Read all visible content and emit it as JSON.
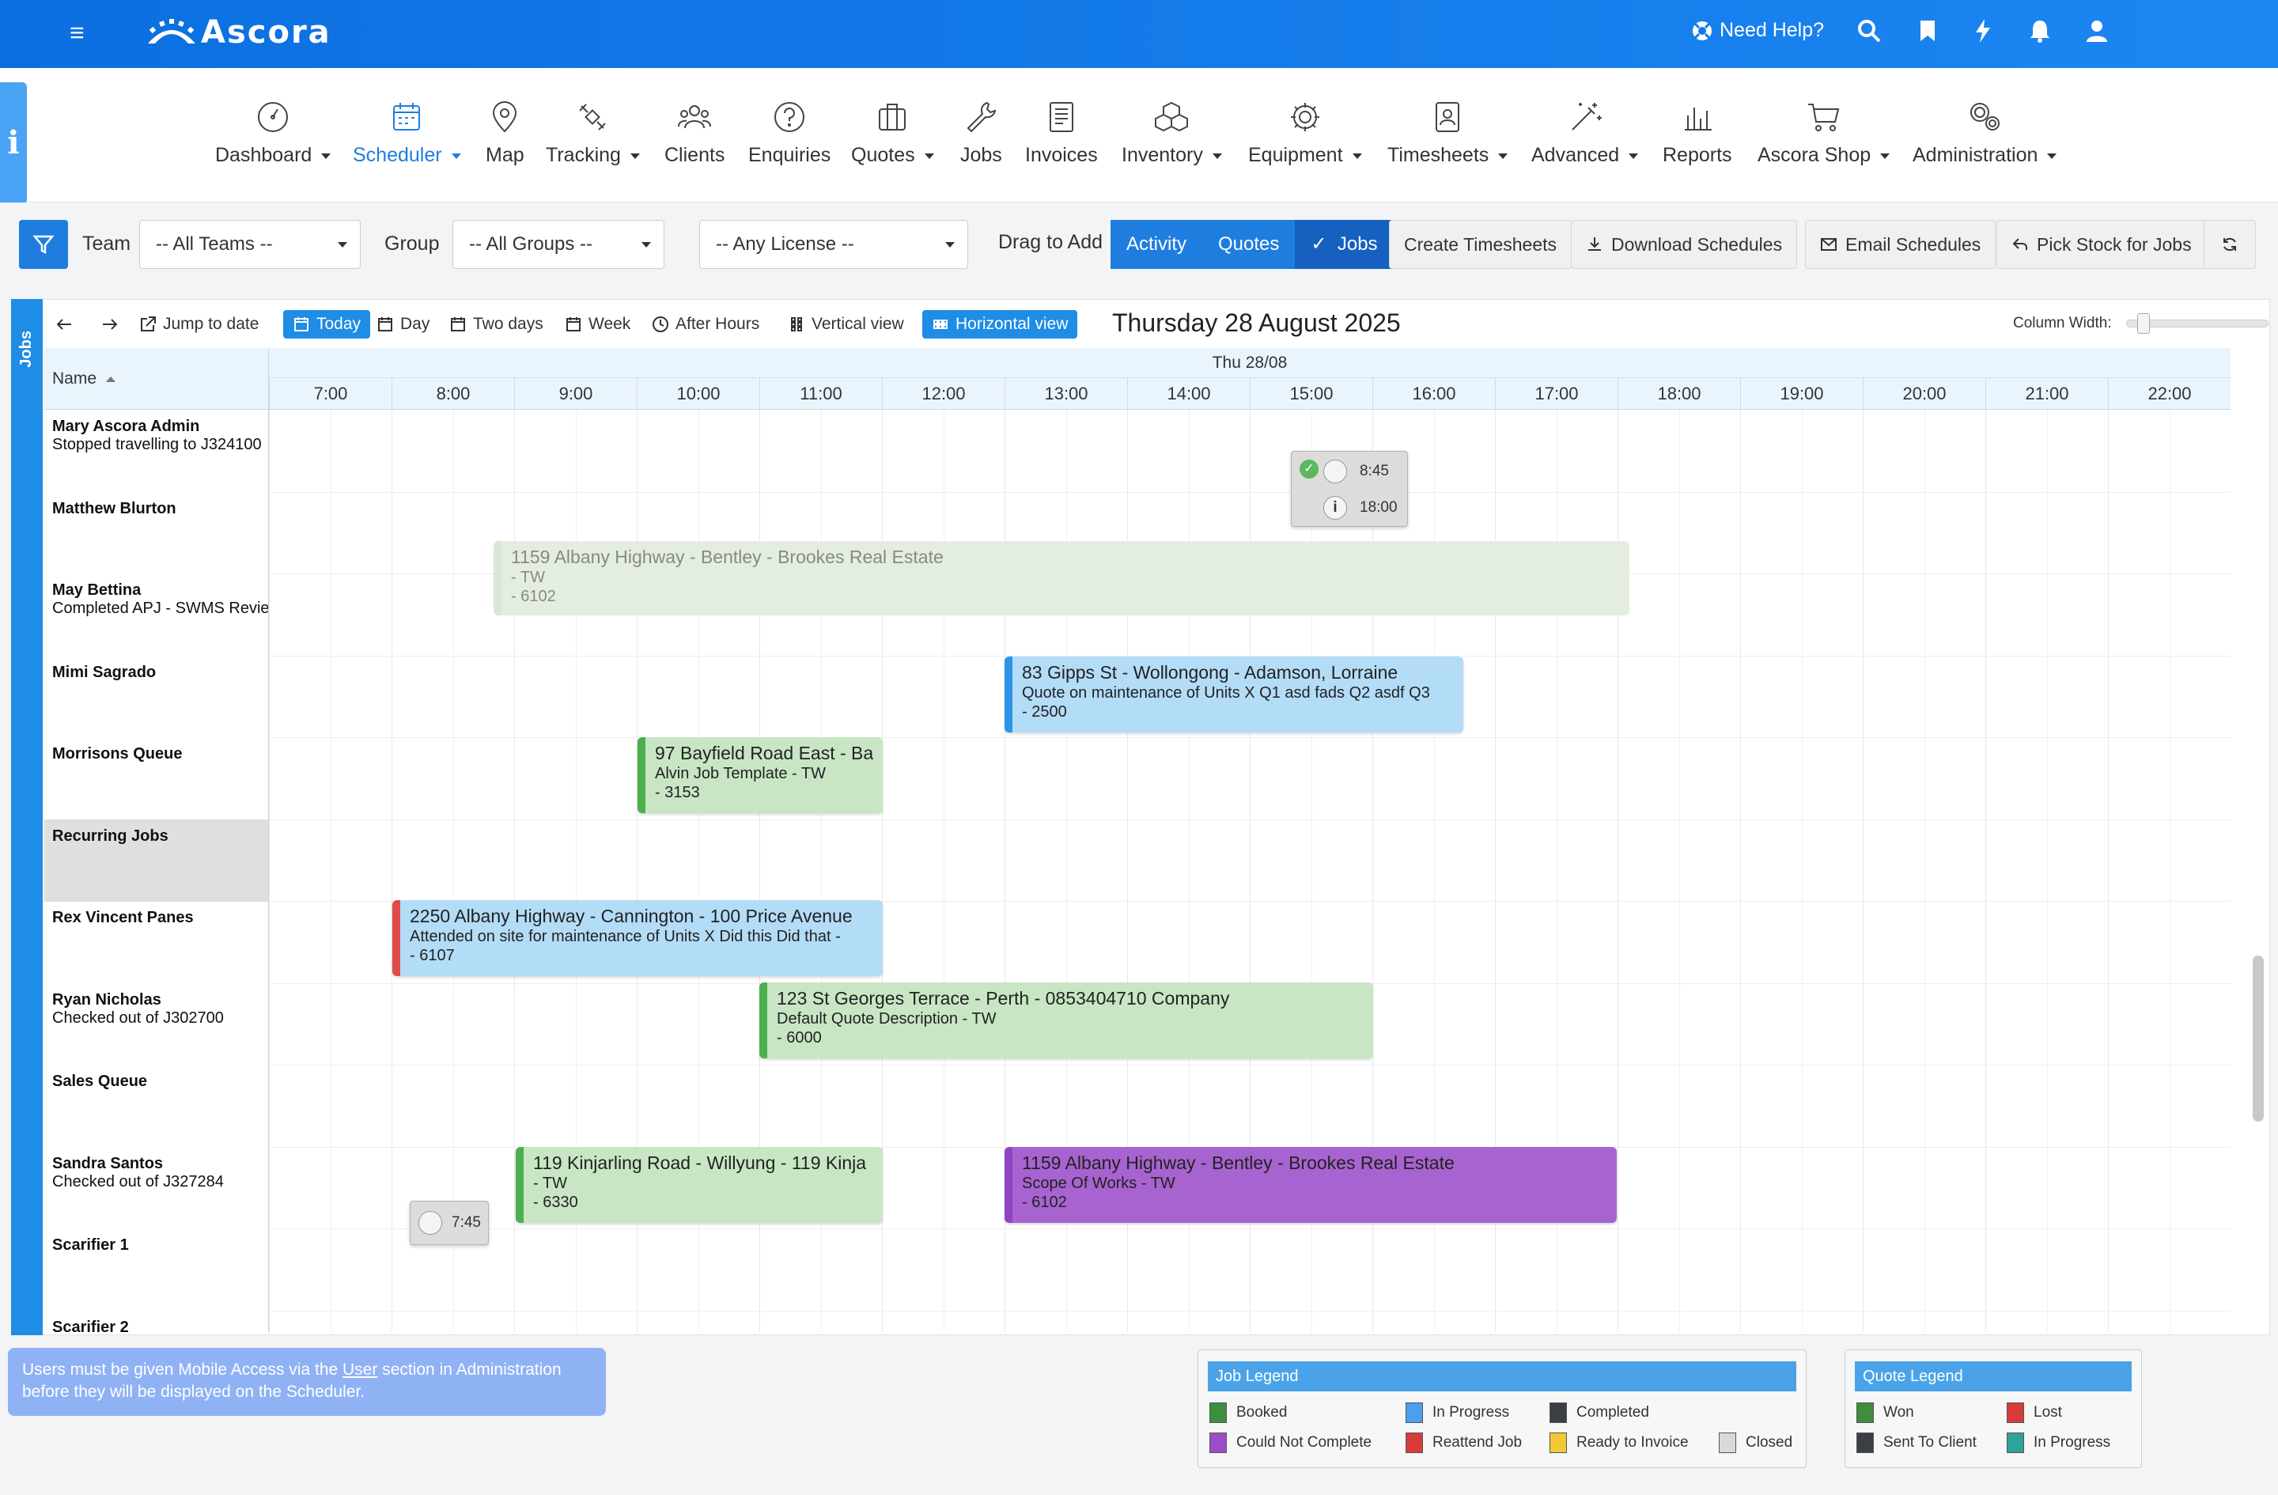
{
  "app": {
    "brand": "Ascora",
    "help_label": "Need Help?"
  },
  "nav": [
    {
      "label": "Dashboard",
      "caret": true
    },
    {
      "label": "Scheduler",
      "caret": true,
      "active": true
    },
    {
      "label": "Map",
      "caret": false
    },
    {
      "label": "Tracking",
      "caret": true
    },
    {
      "label": "Clients",
      "caret": false
    },
    {
      "label": "Enquiries",
      "caret": false
    },
    {
      "label": "Quotes",
      "caret": true
    },
    {
      "label": "Jobs",
      "caret": false
    },
    {
      "label": "Invoices",
      "caret": false
    },
    {
      "label": "Inventory",
      "caret": true
    },
    {
      "label": "Equipment",
      "caret": true
    },
    {
      "label": "Timesheets",
      "caret": true
    },
    {
      "label": "Advanced",
      "caret": true
    },
    {
      "label": "Reports",
      "caret": false
    },
    {
      "label": "Ascora Shop",
      "caret": true
    },
    {
      "label": "Administration",
      "caret": true
    }
  ],
  "filters": {
    "team_label": "Team",
    "team_value": "-- All Teams --",
    "group_label": "Group",
    "group_value": "-- All Groups --",
    "license_value": "-- Any License --",
    "drag_label": "Drag to Add",
    "drag_options": [
      "Activity",
      "Quotes",
      "Jobs"
    ],
    "create_timesheets": "Create Timesheets",
    "download_schedules": "Download Schedules",
    "email_schedules": "Email Schedules",
    "pick_stock": "Pick Stock for Jobs"
  },
  "toolbar": {
    "jump_to_date": "Jump to date",
    "today": "Today",
    "day": "Day",
    "two_days": "Two days",
    "week": "Week",
    "after_hours": "After Hours",
    "vertical_view": "Vertical view",
    "horizontal_view": "Horizontal view",
    "date_title": "Thursday 28 August 2025",
    "column_width": "Column Width:",
    "side_tab": "Jobs"
  },
  "grid": {
    "name_header": "Name",
    "day_header": "Thu 28/08",
    "hours": [
      "7:00",
      "8:00",
      "9:00",
      "10:00",
      "11:00",
      "12:00",
      "13:00",
      "14:00",
      "15:00",
      "16:00",
      "17:00",
      "18:00",
      "19:00",
      "20:00",
      "21:00",
      "22:00"
    ]
  },
  "resources": [
    {
      "name": "Mary Ascora Admin",
      "status": "Stopped travelling to J324100"
    },
    {
      "name": "Matthew Blurton",
      "status": ""
    },
    {
      "name": "May Bettina",
      "status": "Completed APJ - SWMS Review"
    },
    {
      "name": "Mimi Sagrado",
      "status": ""
    },
    {
      "name": "Morrisons Queue",
      "status": ""
    },
    {
      "name": "Recurring Jobs",
      "status": ""
    },
    {
      "name": "Rex Vincent Panes",
      "status": ""
    },
    {
      "name": "Ryan Nicholas",
      "status": "Checked out of J302700"
    },
    {
      "name": "Sales Queue",
      "status": ""
    },
    {
      "name": "Sandra Santos",
      "status": "Checked out of J327284"
    },
    {
      "name": "Scarifier 1",
      "status": ""
    },
    {
      "name": "Scarifier 2",
      "status": ""
    }
  ],
  "events": [
    {
      "title": "1159 Albany Highway - Bentley - Brookes Real Estate",
      "line2": "- TW",
      "line3": "- 6102"
    },
    {
      "title": "83 Gipps St - Wollongong - Adamson, Lorraine",
      "line2": "Quote on maintenance of Units X Q1 asd fads Q2 asdf Q3",
      "line3": "- 2500"
    },
    {
      "title": "97 Bayfield Road East - Ba",
      "line2": "Alvin Job Template - TW",
      "line3": "- 3153"
    },
    {
      "title": "2250 Albany Highway - Cannington - 100 Price Avenue",
      "line2": "Attended on site for maintenance of Units X Did this Did that -",
      "line3": "- 6107"
    },
    {
      "title": "123 St Georges Terrace - Perth - 0853404710 Company",
      "line2": "Default Quote Description - TW",
      "line3": "- 6000"
    },
    {
      "title": "119 Kinjarling Road - Willyung - 119 Kinja",
      "line2": "- TW",
      "line3": "- 6330"
    },
    {
      "title": "1159 Albany Highway - Bentley - Brookes Real Estate",
      "line2": "Scope Of Works   - TW",
      "line3": "- 6102"
    }
  ],
  "bubbles": {
    "mary_start": "8:45",
    "mary_end": "18:00",
    "sandra_time": "7:45"
  },
  "notice": {
    "pre": "Users must be given Mobile Access via the ",
    "link": "User",
    "post": " section in Administration before they will be displayed on the Scheduler."
  },
  "job_legend": {
    "title": "Job Legend",
    "items": [
      {
        "label": "Booked",
        "color": "#3e8e3e"
      },
      {
        "label": "In Progress",
        "color": "#4a9ff0"
      },
      {
        "label": "Completed",
        "color": "#3a3f45"
      },
      {
        "label": "Could Not Complete",
        "color": "#9b4dc9"
      },
      {
        "label": "Reattend Job",
        "color": "#d93a3a"
      },
      {
        "label": "Ready to Invoice",
        "color": "#f2c935"
      },
      {
        "label": "Closed",
        "color": "#d9d9d9"
      }
    ]
  },
  "quote_legend": {
    "title": "Quote Legend",
    "items": [
      {
        "label": "Won",
        "color": "#3e8e3e"
      },
      {
        "label": "Lost",
        "color": "#d93a3a"
      },
      {
        "label": "Sent To Client",
        "color": "#3a3f45"
      },
      {
        "label": "In Progress",
        "color": "#2fa39a"
      }
    ]
  },
  "colors": {
    "brand_blue": "#1f7de0",
    "top_bar": "#0b6fe0"
  }
}
